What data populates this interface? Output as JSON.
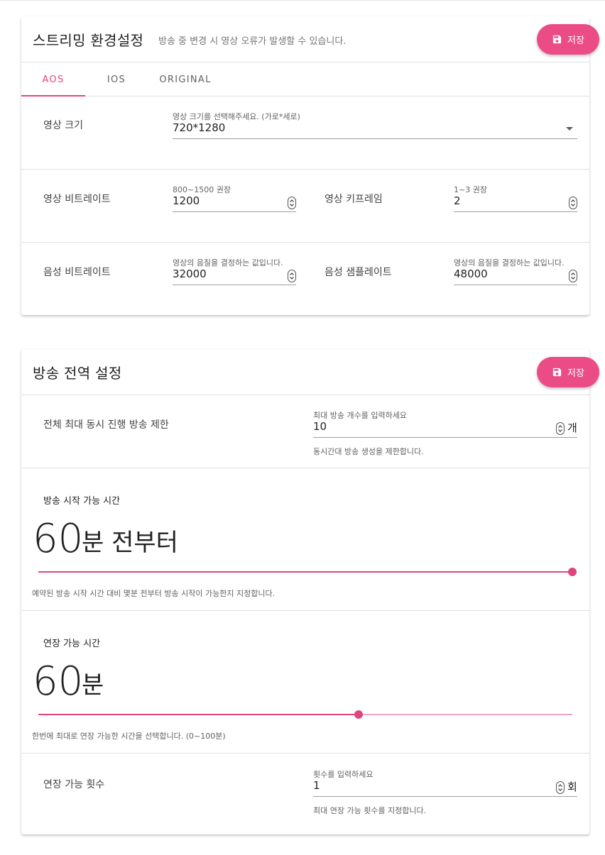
{
  "streaming": {
    "title": "스트리밍 환경설정",
    "subtitle": "방송 중 변경 시 영상 오류가 발생할 수 있습니다.",
    "save_label": "저장",
    "tabs": [
      {
        "label": "AOS",
        "active": true
      },
      {
        "label": "IOS",
        "active": false
      },
      {
        "label": "ORIGINAL",
        "active": false
      }
    ],
    "video_size": {
      "label": "영상 크기",
      "field_label": "영상 크기를 선택해주세요. (가로*세로)",
      "value": "720*1280"
    },
    "video_bitrate": {
      "label": "영상 비트레이트",
      "field_label": "800~1500 권장",
      "value": "1200"
    },
    "video_keyframe": {
      "label": "영상 키프레임",
      "field_label": "1~3 권장",
      "value": "2"
    },
    "audio_bitrate": {
      "label": "음성 비트레이트",
      "field_label": "영상의 음질을 결정하는 값입니다.",
      "value": "32000"
    },
    "audio_samplerate": {
      "label": "음성 샘플레이트",
      "field_label": "영상의 음질을 결정하는 값입니다.",
      "value": "48000"
    }
  },
  "global": {
    "title": "방송 전역 설정",
    "save_label": "저장",
    "max_concurrent": {
      "label": "전체 최대 동시 진행 방송 제한",
      "field_label": "최대 방송 개수를 입력하세요",
      "value": "10",
      "suffix": "개",
      "hint": "동시간대 방송 생성을 제한합니다."
    },
    "start_time": {
      "label": "방송 시작 가능 시간",
      "value": "60",
      "unit": "분 전부터",
      "slider_fraction": 1.0,
      "hint": "예약된 방송 시작 시간 대비 몇분 전부터 방송 시작이 가능한지 지정합니다."
    },
    "extend_time": {
      "label": "연장 가능 시간",
      "value": "60",
      "unit": "분",
      "slider_fraction": 0.6,
      "hint": "한번에 최대로 연장 가능한 시간을 선택합니다. (0~100분)"
    },
    "extend_count": {
      "label": "연장 가능 횟수",
      "field_label": "횟수를 입력하세요",
      "value": "1",
      "suffix": "회",
      "hint": "최대 연장 가능 횟수를 지정합니다."
    }
  },
  "colors": {
    "accent": "#e5457d",
    "button": "#ec4c86",
    "slider_inactive": "#f3a3c6"
  }
}
